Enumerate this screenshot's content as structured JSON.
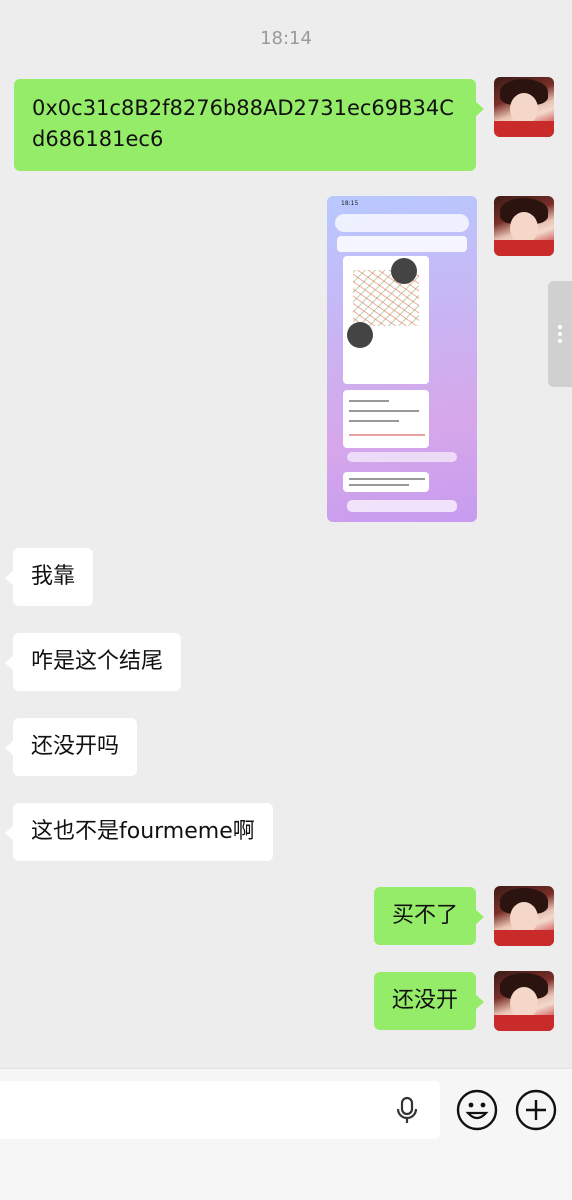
{
  "timestamp": "18:14",
  "messages": {
    "address": "0x0c31c8B2f8276b88AD2731ec69B34Cd686181ec6",
    "other": [
      "我靠",
      "咋是这个结尾",
      "还没开吗",
      "这也不是fourmeme啊"
    ],
    "me": [
      "买不了",
      "还没开"
    ]
  },
  "screenshot_thumb": {
    "status_time": "18:15"
  },
  "icons": {
    "side": "more-dots-icon",
    "mic": "microphone-icon",
    "emoji": "emoji-icon",
    "plus": "plus-icon"
  },
  "colors": {
    "background": "#ededed",
    "my_bubble": "#95ec69",
    "other_bubble": "#ffffff"
  }
}
